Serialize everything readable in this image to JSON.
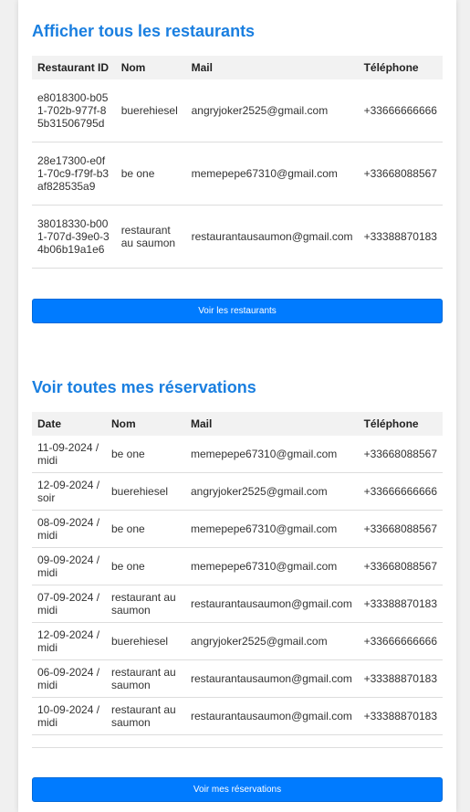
{
  "restaurants_section": {
    "title": "Afficher tous les restaurants",
    "columns": [
      "Restaurant ID",
      "Nom",
      "Mail",
      "Téléphone"
    ],
    "rows": [
      [
        "e8018300-b051-702b-977f-85b31506795d",
        "buerehiesel",
        "angryjoker2525@gmail.com",
        "+33666666666"
      ],
      [
        "28e17300-e0f1-70c9-f79f-b3af828535a9",
        "be one",
        "memepepe67310@gmail.com",
        "+33668088567"
      ],
      [
        "38018330-b001-707d-39e0-34b06b19a1e6",
        "restaurant au saumon",
        "restaurantausaumon@gmail.com",
        "+33388870183"
      ]
    ],
    "button_label": "Voir les restaurants"
  },
  "reservations_section": {
    "title": "Voir toutes mes réservations",
    "columns": [
      "Date",
      "Nom",
      "Mail",
      "Téléphone"
    ],
    "rows": [
      [
        "11-09-2024 / midi",
        "be one",
        "memepepe67310@gmail.com",
        "+33668088567"
      ],
      [
        "12-09-2024 / soir",
        "buerehiesel",
        "angryjoker2525@gmail.com",
        "+33666666666"
      ],
      [
        "08-09-2024 / midi",
        "be one",
        "memepepe67310@gmail.com",
        "+33668088567"
      ],
      [
        "09-09-2024 / midi",
        "be one",
        "memepepe67310@gmail.com",
        "+33668088567"
      ],
      [
        "07-09-2024 / midi",
        "restaurant au saumon",
        "restaurantausaumon@gmail.com",
        "+33388870183"
      ],
      [
        "12-09-2024 / midi",
        "buerehiesel",
        "angryjoker2525@gmail.com",
        "+33666666666"
      ],
      [
        "06-09-2024 / midi",
        "restaurant au saumon",
        "restaurantausaumon@gmail.com",
        "+33388870183"
      ],
      [
        "10-09-2024 / midi",
        "restaurant au saumon",
        "restaurantausaumon@gmail.com",
        "+33388870183"
      ]
    ],
    "button_label": "Voir mes réservations"
  },
  "colors": {
    "accent": "#1a7fe0",
    "button": "#007bff",
    "header_bg": "#f2f2f2"
  }
}
